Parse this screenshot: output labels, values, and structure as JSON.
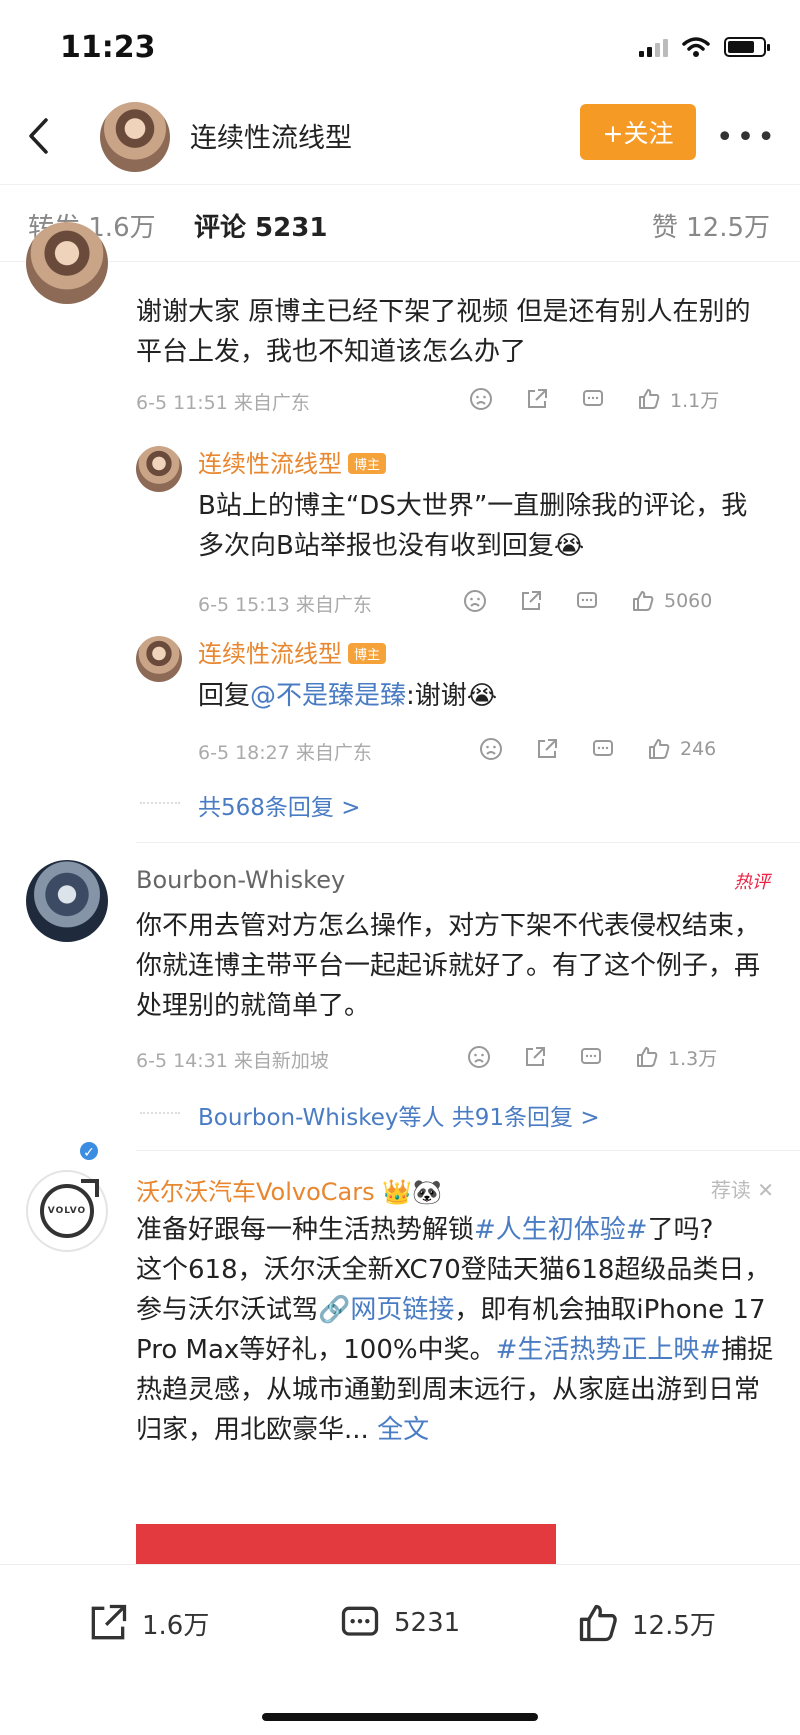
{
  "status_bar": {
    "time": "11:23"
  },
  "header": {
    "title": "连续性流线型",
    "follow_label": "+关注",
    "more_label": "•••"
  },
  "stats": {
    "repost": "转发 1.6万",
    "comments": "评论 5231",
    "likes": "赞 12.5万"
  },
  "comments": [
    {
      "name": "连续性流线型",
      "text": "谢谢大家 原博主已经下架了视频 但是还有别人在别的平台上发，我也不知道该怎么办了",
      "meta": "6-5 11:51 来自广东",
      "likes": "1.1万",
      "replies": [
        {
          "name": "连续性流线型",
          "badge": "博主",
          "text": "B站上的博主“DS大世界”一直删除我的评论，我多次向B站举报也没有收到回复😭",
          "meta": "6-5 15:13 来自广东",
          "likes": "5060"
        },
        {
          "name": "连续性流线型",
          "badge": "博主",
          "text_prefix": "回复",
          "mention": "@不是臻是臻",
          "text_suffix": ":谢谢😭",
          "meta": "6-5 18:27 来自广东",
          "likes": "246"
        }
      ],
      "more_replies": "共568条回复 >"
    },
    {
      "name": "Bourbon-Whiskey",
      "tag": "热评",
      "text": "你不用去管对方怎么操作，对方下架不代表侵权结束，你就连博主带平台一起起诉就好了。有了这个例子，再处理别的就简单了。",
      "meta": "6-5 14:31 来自新加坡",
      "likes": "1.3万",
      "more_replies_who": "Bourbon-Whiskey等人",
      "more_replies": "共91条回复 >"
    }
  ],
  "ad": {
    "name": "沃尔沃汽车VolvoCars 👑🐼",
    "tag": "荐读 ✕",
    "logo_text": "VOLVO",
    "text_1": "准备好跟每一种生活热势解锁",
    "link_1": "#人生初体验#",
    "text_2": "了吗?",
    "text_3": "这个618，沃尔沃全新XC70登陆天猫618超级品类日，参与沃尔沃试驾",
    "link_2": "🔗网页链接",
    "text_4": "，即有机会抽取iPhone 17 Pro Max等好礼，100%中奖。",
    "link_3": "#生活热势正上映#",
    "text_5": "捕捉热趋灵感，从城市通勤到周末远行，从家庭出游到日常归家，用北欧豪华...",
    "link_4": "全文"
  },
  "bottom_bar": {
    "repost": "1.6万",
    "comments": "5231",
    "likes": "12.5万"
  }
}
